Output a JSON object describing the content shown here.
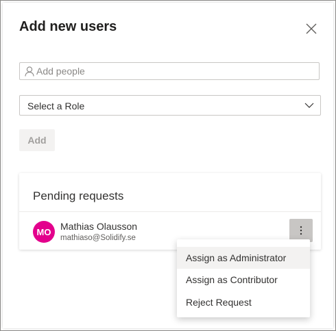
{
  "dialog": {
    "title": "Add new users",
    "close_icon": "close-icon"
  },
  "search": {
    "placeholder": "Add people",
    "value": "",
    "icon": "person-icon"
  },
  "role_select": {
    "selected": "Select a Role",
    "icon": "chevron-down-icon"
  },
  "add_button": {
    "label": "Add",
    "disabled": true
  },
  "pending": {
    "title": "Pending requests",
    "requests": [
      {
        "initials": "MO",
        "name": "Mathias Olausson",
        "email": "mathiaso@Solidify.se",
        "avatar_color": "#e3008c"
      }
    ],
    "more_icon": "more-vertical-icon"
  },
  "context_menu": {
    "items": [
      {
        "label": "Assign as Administrator"
      },
      {
        "label": "Assign as Contributor"
      },
      {
        "label": "Reject Request"
      }
    ],
    "hovered_index": 0
  },
  "colors": {
    "accent": "#0078d4",
    "avatar": "#e3008c",
    "disabled_bg": "#f3f2f1",
    "disabled_text": "#a19f9d"
  }
}
